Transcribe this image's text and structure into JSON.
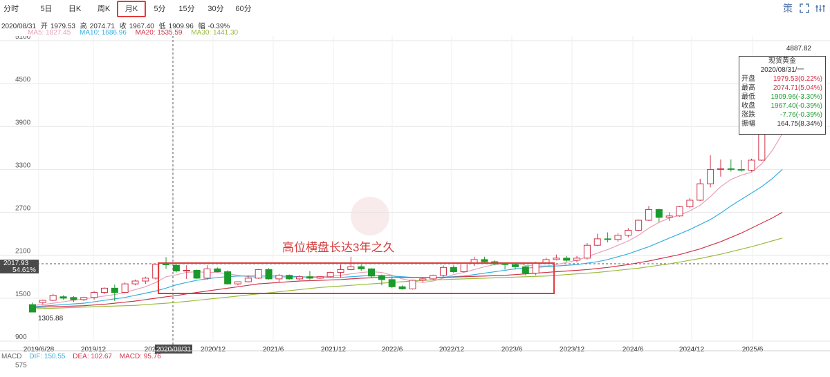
{
  "tabs": [
    {
      "label": "分时",
      "active": false
    },
    {
      "label": "5日",
      "active": false
    },
    {
      "label": "日K",
      "active": false
    },
    {
      "label": "周K",
      "active": false
    },
    {
      "label": "月K",
      "active": true
    },
    {
      "label": "5分",
      "active": false
    },
    {
      "label": "15分",
      "active": false
    },
    {
      "label": "30分",
      "active": false
    },
    {
      "label": "60分",
      "active": false
    }
  ],
  "toolbar": {
    "icons": [
      "strategy-icon",
      "expand-icon",
      "settings-icon"
    ],
    "strategy_glyph": "策"
  },
  "info": {
    "date": "2020/08/31",
    "open_label": "开",
    "open": "1979.53",
    "high_label": "高",
    "high": "2074.71",
    "close_label": "收",
    "close": "1967.40",
    "low_label": "低",
    "low": "1909.96",
    "amp_label": "幅",
    "change_pct": "-0.39%"
  },
  "ma": {
    "ma5": "MA5: 1827.45",
    "ma10": "MA10: 1686.96",
    "ma20": "MA20: 1535.59",
    "ma30": "MA30: 1441.30",
    "colors": {
      "ma5": "#e8a0b4",
      "ma10": "#35aee0",
      "ma20": "#d0334a",
      "ma30": "#9bbb3c"
    }
  },
  "price_tag": {
    "price": "2017.93",
    "pct": "54.61%"
  },
  "tooltip": {
    "title": "现货黄金",
    "date": "2020/08/31/一",
    "rows": [
      {
        "label": "开盘",
        "value": "1979.53(0.22%)",
        "color": "red"
      },
      {
        "label": "最高",
        "value": "2074.71(5.04%)",
        "color": "red"
      },
      {
        "label": "最低",
        "value": "1909.96(-3.30%)",
        "color": "green"
      },
      {
        "label": "收盘",
        "value": "1967.40(-0.39%)",
        "color": "green"
      },
      {
        "label": "涨跌",
        "value": "-7.76(-0.39%)",
        "color": "green"
      },
      {
        "label": "振幅",
        "value": "164.75(8.34%)",
        "color": "normal"
      }
    ]
  },
  "annotation": "高位横盘长达3年之久",
  "macd": {
    "label": "MACD",
    "dif": "DIF: 150.55",
    "dea": "DEA: 102.67",
    "macd": "MACD: 95.76",
    "value": "575"
  },
  "chart_data": {
    "type": "candlestick",
    "y_ticks": [
      900,
      1500,
      2100,
      2700,
      3300,
      3900,
      4500,
      5100
    ],
    "ylim": [
      900,
      5100
    ],
    "x_ticks": [
      "2019/6/28",
      "2019/12",
      "2020/08/31",
      "2020/12",
      "2021/6",
      "2021/12",
      "2022/6",
      "2022/12",
      "2023/6",
      "2023/12",
      "2024/6",
      "2024/12",
      "2025/6"
    ],
    "crosshair_date": "2020/08/31",
    "low_label": "1305.88",
    "high_label": "4887.82",
    "ohlc": [
      [
        1410,
        1440,
        1390,
        1305.88
      ],
      [
        1440,
        1480,
        1410,
        1470
      ],
      [
        1470,
        1560,
        1460,
        1540
      ],
      [
        1520,
        1540,
        1480,
        1500
      ],
      [
        1510,
        1530,
        1450,
        1480
      ],
      [
        1480,
        1520,
        1460,
        1510
      ],
      [
        1510,
        1600,
        1480,
        1580
      ],
      [
        1580,
        1650,
        1560,
        1640
      ],
      [
        1640,
        1690,
        1460,
        1580
      ],
      [
        1580,
        1720,
        1570,
        1700
      ],
      [
        1700,
        1760,
        1680,
        1740
      ],
      [
        1740,
        1800,
        1700,
        1780
      ],
      [
        1780,
        1980,
        1760,
        1975
      ],
      [
        1979.53,
        2074.71,
        1909.96,
        1967.4
      ],
      [
        1960,
        1990,
        1860,
        1880
      ],
      [
        1880,
        1960,
        1770,
        1890
      ],
      [
        1890,
        1900,
        1770,
        1780
      ],
      [
        1780,
        1960,
        1760,
        1910
      ],
      [
        1910,
        1930,
        1860,
        1870
      ],
      [
        1870,
        1890,
        1690,
        1700
      ],
      [
        1700,
        1730,
        1680,
        1730
      ],
      [
        1730,
        1820,
        1720,
        1780
      ],
      [
        1780,
        1910,
        1770,
        1900
      ],
      [
        1900,
        1920,
        1760,
        1770
      ],
      [
        1770,
        1840,
        1720,
        1820
      ],
      [
        1820,
        1830,
        1760,
        1770
      ],
      [
        1770,
        1820,
        1750,
        1800
      ],
      [
        1800,
        1880,
        1760,
        1780
      ],
      [
        1780,
        1810,
        1770,
        1800
      ],
      [
        1800,
        1870,
        1790,
        1860
      ],
      [
        1860,
        1970,
        1790,
        1900
      ],
      [
        1900,
        2080,
        1890,
        1940
      ],
      [
        1940,
        1970,
        1880,
        1910
      ],
      [
        1910,
        1920,
        1780,
        1810
      ],
      [
        1810,
        1830,
        1680,
        1760
      ],
      [
        1760,
        1790,
        1640,
        1660
      ],
      [
        1660,
        1680,
        1620,
        1630
      ],
      [
        1630,
        1760,
        1620,
        1750
      ],
      [
        1750,
        1790,
        1720,
        1770
      ],
      [
        1770,
        1830,
        1760,
        1820
      ],
      [
        1820,
        1960,
        1800,
        1930
      ],
      [
        1930,
        1960,
        1850,
        1870
      ],
      [
        1870,
        2000,
        1860,
        1990
      ],
      [
        1990,
        2080,
        1950,
        2040
      ],
      [
        2040,
        2080,
        1990,
        2010
      ],
      [
        2010,
        2030,
        1960,
        1980
      ],
      [
        1980,
        1990,
        1900,
        1970
      ],
      [
        1970,
        1990,
        1900,
        1940
      ],
      [
        1940,
        1950,
        1820,
        1850
      ],
      [
        1850,
        2010,
        1820,
        1990
      ],
      [
        1990,
        2070,
        1980,
        2040
      ],
      [
        2040,
        2110,
        2030,
        2060
      ],
      [
        2060,
        2090,
        2010,
        2030
      ],
      [
        2030,
        2090,
        2000,
        2060
      ],
      [
        2060,
        2270,
        2040,
        2240
      ],
      [
        2240,
        2400,
        2230,
        2330
      ],
      [
        2330,
        2420,
        2280,
        2320
      ],
      [
        2320,
        2410,
        2290,
        2380
      ],
      [
        2380,
        2480,
        2350,
        2450
      ],
      [
        2450,
        2600,
        2440,
        2590
      ],
      [
        2590,
        2790,
        2580,
        2740
      ],
      [
        2740,
        2750,
        2560,
        2630
      ],
      [
        2630,
        2700,
        2580,
        2650
      ],
      [
        2650,
        2790,
        2640,
        2780
      ],
      [
        2780,
        2900,
        2760,
        2870
      ],
      [
        2870,
        3170,
        2860,
        3100
      ],
      [
        3100,
        3500,
        3050,
        3300
      ],
      [
        3300,
        3440,
        3200,
        3310
      ],
      [
        3310,
        3440,
        3270,
        3300
      ],
      [
        3300,
        3430,
        3270,
        3290
      ],
      [
        3290,
        3450,
        3270,
        3430
      ],
      [
        3430,
        3980,
        3420,
        3860
      ],
      [
        3860,
        4400,
        3840,
        4340
      ],
      [
        4340,
        4887.82,
        4300,
        4850
      ]
    ],
    "ma_series": {
      "MA5": [
        1400,
        1410,
        1430,
        1450,
        1470,
        1490,
        1510,
        1530,
        1550,
        1580,
        1620,
        1660,
        1720,
        1800,
        1827.45,
        1860,
        1870,
        1860,
        1860,
        1840,
        1820,
        1800,
        1790,
        1780,
        1790,
        1790,
        1790,
        1800,
        1800,
        1810,
        1820,
        1840,
        1860,
        1870,
        1860,
        1820,
        1770,
        1740,
        1720,
        1740,
        1780,
        1830,
        1860,
        1900,
        1940,
        1970,
        1980,
        1990,
        1960,
        1950,
        1950,
        1970,
        2000,
        2030,
        2080,
        2130,
        2180,
        2240,
        2300,
        2380,
        2480,
        2560,
        2620,
        2660,
        2720,
        2800,
        2920,
        3060,
        3160,
        3220,
        3260,
        3380,
        3560,
        3800
      ],
      "MA10": [
        1380,
        1390,
        1400,
        1410,
        1420,
        1430,
        1450,
        1470,
        1490,
        1510,
        1540,
        1570,
        1600,
        1640,
        1686.96,
        1720,
        1750,
        1770,
        1790,
        1800,
        1810,
        1810,
        1810,
        1810,
        1810,
        1805,
        1800,
        1795,
        1790,
        1790,
        1790,
        1800,
        1810,
        1820,
        1820,
        1810,
        1800,
        1790,
        1790,
        1790,
        1795,
        1800,
        1810,
        1830,
        1850,
        1870,
        1890,
        1910,
        1920,
        1930,
        1940,
        1950,
        1960,
        1970,
        1990,
        2010,
        2040,
        2080,
        2120,
        2170,
        2220,
        2280,
        2340,
        2400,
        2460,
        2530,
        2600,
        2690,
        2790,
        2880,
        2970,
        3060,
        3170,
        3300
      ],
      "MA20": [
        1370,
        1375,
        1380,
        1385,
        1390,
        1395,
        1405,
        1415,
        1430,
        1445,
        1460,
        1480,
        1500,
        1520,
        1535.59,
        1560,
        1580,
        1600,
        1620,
        1640,
        1660,
        1680,
        1700,
        1710,
        1720,
        1730,
        1740,
        1745,
        1750,
        1755,
        1760,
        1770,
        1780,
        1785,
        1790,
        1790,
        1790,
        1790,
        1790,
        1790,
        1790,
        1795,
        1800,
        1805,
        1810,
        1815,
        1820,
        1830,
        1840,
        1850,
        1860,
        1870,
        1880,
        1890,
        1900,
        1915,
        1930,
        1950,
        1970,
        1995,
        2020,
        2050,
        2080,
        2110,
        2150,
        2190,
        2240,
        2290,
        2350,
        2410,
        2480,
        2550,
        2620,
        2700
      ],
      "MA30": [
        1350,
        1355,
        1360,
        1365,
        1370,
        1375,
        1380,
        1385,
        1390,
        1395,
        1400,
        1410,
        1420,
        1430,
        1441.3,
        1455,
        1470,
        1485,
        1500,
        1515,
        1530,
        1545,
        1560,
        1575,
        1590,
        1605,
        1620,
        1635,
        1650,
        1660,
        1670,
        1680,
        1690,
        1700,
        1710,
        1720,
        1730,
        1740,
        1750,
        1755,
        1760,
        1765,
        1770,
        1775,
        1780,
        1785,
        1790,
        1795,
        1800,
        1805,
        1810,
        1820,
        1830,
        1840,
        1850,
        1860,
        1875,
        1890,
        1905,
        1920,
        1940,
        1960,
        1980,
        2005,
        2030,
        2055,
        2085,
        2115,
        2150,
        2185,
        2220,
        2260,
        2300,
        2340
      ]
    }
  }
}
